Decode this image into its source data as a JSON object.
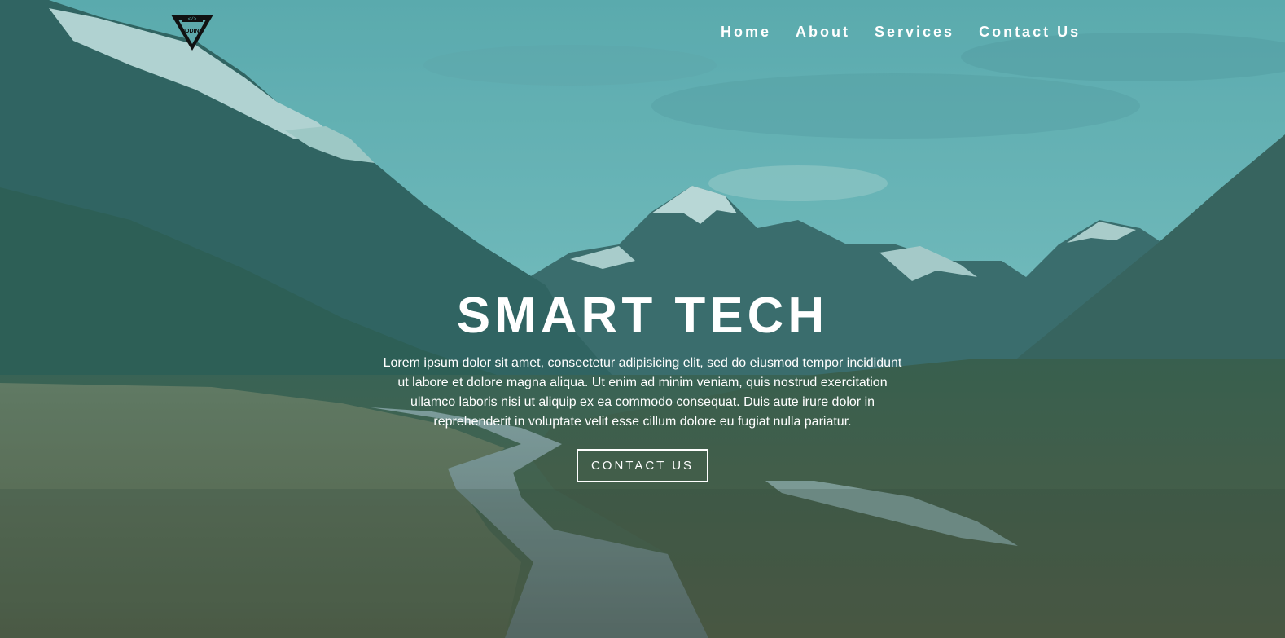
{
  "logo": {
    "icon": "coding-logo-icon",
    "text": "CODING",
    "subtext": "NATION"
  },
  "nav": {
    "items": [
      {
        "label": "Home"
      },
      {
        "label": "About"
      },
      {
        "label": "Services"
      },
      {
        "label": "Contact Us"
      }
    ]
  },
  "hero": {
    "title": "SMART TECH",
    "description": "Lorem ipsum dolor sit amet, consectetur adipisicing elit, sed do eiusmod tempor incididunt ut labore et dolore magna aliqua. Ut enim ad minim veniam, quis nostrud exercitation ullamco laboris nisi ut aliquip ex ea commodo consequat. Duis aute irure dolor in reprehenderit in voluptate velit esse cillum dolore eu fugiat nulla pariatur.",
    "cta_label": "CONTACT US",
    "background": "mountain-valley-boardwalk-image"
  },
  "colors": {
    "text": "#ffffff",
    "overlay": "#2a787d",
    "sky": "#7fc4c6"
  }
}
